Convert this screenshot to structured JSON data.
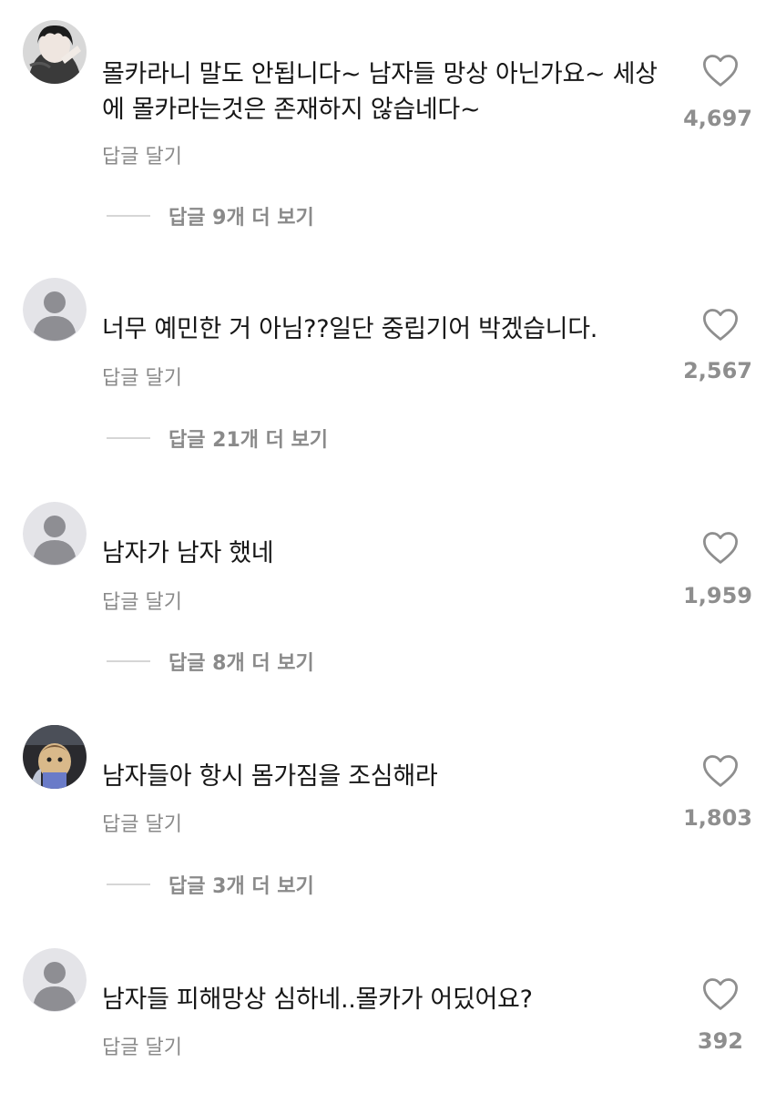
{
  "comments": [
    {
      "avatar": "photo-avatar-anime",
      "text": "몰카라니 말도 안됩니다~ 남자들 망상 아닌가요~ 세상에 몰카라는것은 존재하지 않습네다~",
      "reply_label": "답글 달기",
      "likes": "4,697",
      "view_replies": "답글 9개 더 보기"
    },
    {
      "avatar": "default-avatar",
      "text": "너무 예민한 거 아님??일단 중립기어 박겠습니다.",
      "reply_label": "답글 달기",
      "likes": "2,567",
      "view_replies": "답글 21개 더 보기"
    },
    {
      "avatar": "default-avatar",
      "text": "남자가 남자 했네",
      "reply_label": "답글 달기",
      "likes": "1,959",
      "view_replies": "답글 8개 더 보기"
    },
    {
      "avatar": "photo-avatar-toy",
      "text": "남자들아 항시 몸가짐을 조심해라",
      "reply_label": "답글 달기",
      "likes": "1,803",
      "view_replies": "답글 3개 더 보기"
    },
    {
      "avatar": "default-avatar",
      "text": "남자들 피해망상 심하네..몰카가 어딨어요?",
      "reply_label": "답글 달기",
      "likes": "392"
    }
  ],
  "colors": {
    "text": "#161616",
    "muted": "#8a8a8a",
    "avatar_bg": "#e4e4e8",
    "avatar_fg": "#8e8e93"
  }
}
